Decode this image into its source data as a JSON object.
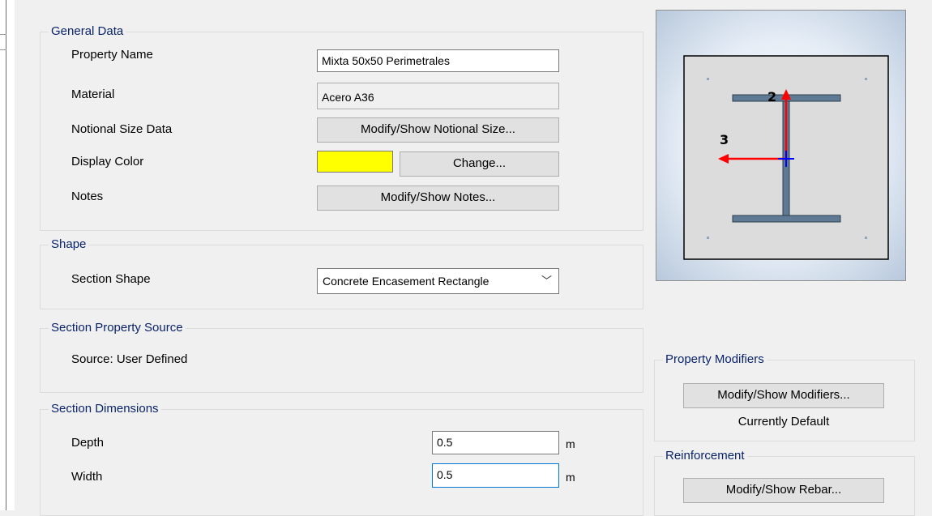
{
  "general": {
    "legend": "General Data",
    "property_name_label": "Property Name",
    "property_name_value": "Mixta 50x50 Perimetrales",
    "material_label": "Material",
    "material_value": "Acero A36",
    "notional_label": "Notional Size Data",
    "notional_button": "Modify/Show Notional Size...",
    "display_color_label": "Display Color",
    "display_color": "#ffff00",
    "change_button": "Change...",
    "notes_label": "Notes",
    "notes_button": "Modify/Show Notes..."
  },
  "shape": {
    "legend": "Shape",
    "section_shape_label": "Section Shape",
    "section_shape_value": "Concrete Encasement Rectangle"
  },
  "source": {
    "legend": "Section Property Source",
    "source_text": "Source:  User Defined"
  },
  "dimensions": {
    "legend": "Section Dimensions",
    "depth_label": "Depth",
    "depth_value": "0.5",
    "depth_unit": "m",
    "width_label": "Width",
    "width_value": "0.5",
    "width_unit": "m"
  },
  "preview": {
    "axis_2_label": "2",
    "axis_3_label": "3"
  },
  "modifiers": {
    "legend": "Property Modifiers",
    "button": "Modify/Show Modifiers...",
    "status": "Currently Default"
  },
  "reinforcement": {
    "legend": "Reinforcement",
    "button": "Modify/Show Rebar..."
  }
}
